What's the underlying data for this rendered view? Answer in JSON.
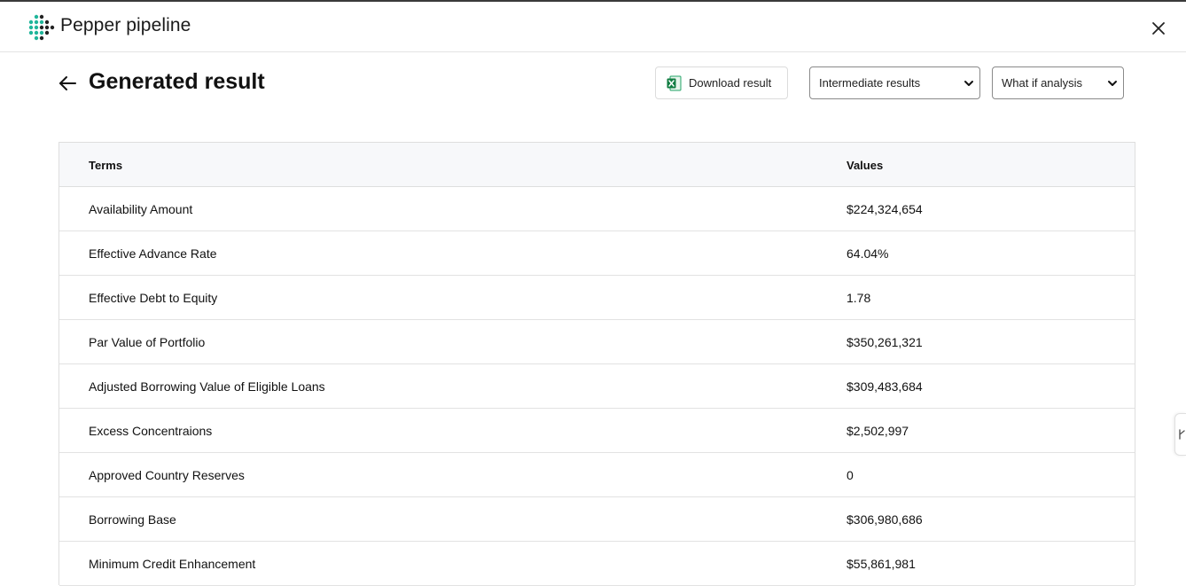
{
  "app": {
    "title": "Pepper pipeline",
    "logo_icon": "dot-grid-logo-icon",
    "accent_color": "#1fb59a"
  },
  "page": {
    "title": "Generated result"
  },
  "toolbar": {
    "download_label": "Download result",
    "intermediate_select": {
      "selected": "Intermediate results"
    },
    "whatif_select": {
      "selected": "What if analysis"
    }
  },
  "table": {
    "headers": {
      "terms": "Terms",
      "values": "Values"
    },
    "rows": [
      {
        "term": "Availability Amount",
        "value": "$224,324,654"
      },
      {
        "term": "Effective Advance Rate",
        "value": "64.04%"
      },
      {
        "term": "Effective Debt to Equity",
        "value": "1.78"
      },
      {
        "term": "Par Value of Portfolio",
        "value": "$350,261,321"
      },
      {
        "term": "Adjusted Borrowing Value of Eligible Loans",
        "value": "$309,483,684"
      },
      {
        "term": "Excess Concentraions",
        "value": "$2,502,997"
      },
      {
        "term": "Approved Country Reserves",
        "value": "0"
      },
      {
        "term": "Borrowing Base",
        "value": "$306,980,686"
      },
      {
        "term": "Minimum Credit Enhancement",
        "value": "$55,861,981"
      }
    ]
  }
}
